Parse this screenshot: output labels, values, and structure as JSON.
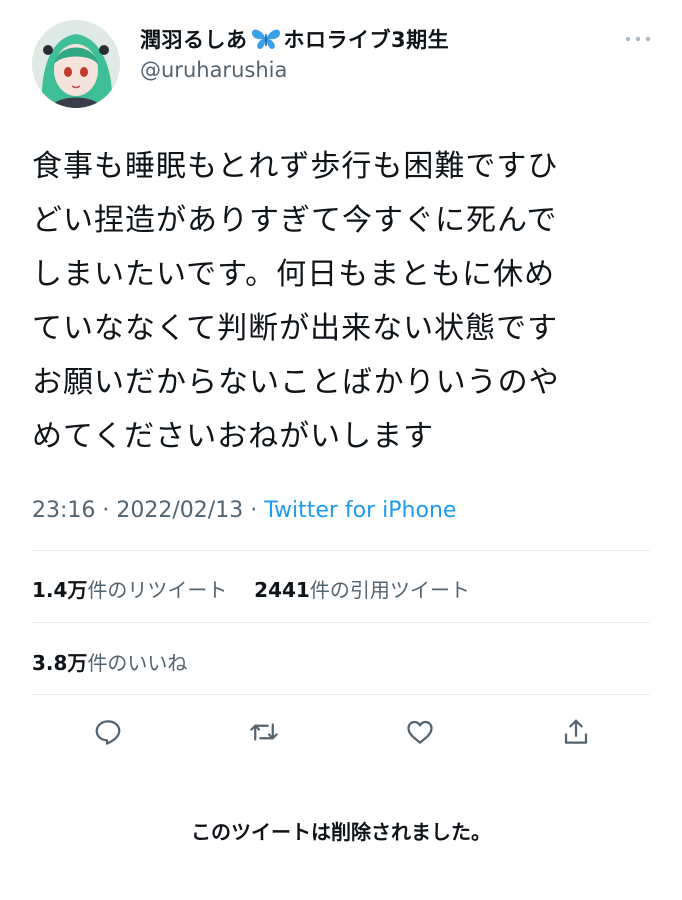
{
  "author": {
    "name_before": "潤羽るしあ",
    "name_after": "ホロライブ3期生",
    "handle": "@uruharushia"
  },
  "tweet": {
    "text": "食事も睡眠もとれず歩行も困難ですひ\nどい捏造がありすぎて今すぐに死んで\nしまいたいです。何日もまともに休め\nていななくて判断が出来ない状態です\nお願いだからないことばかりいうのや\nめてくださいおねがいします",
    "time": "23:16",
    "sep1": " · ",
    "date": "2022/02/13",
    "sep2": " · ",
    "source": "Twitter for iPhone"
  },
  "stats": {
    "retweets_count": "1.4万",
    "retweets_label": "件のリツイート",
    "quotes_count": "2441",
    "quotes_label": "件の引用ツイート",
    "likes_count": "3.8万",
    "likes_label": "件のいいね"
  },
  "icons": {
    "reply": "reply-icon",
    "retweet": "retweet-icon",
    "like": "like-icon",
    "share": "share-icon",
    "more": "more-icon",
    "verified_emoji": "butterfly-icon"
  },
  "colors": {
    "link": "#1d9bf0",
    "secondary_text": "#536471",
    "butterfly": "#3aa0e8"
  },
  "notice": "このツイートは削除されました。"
}
